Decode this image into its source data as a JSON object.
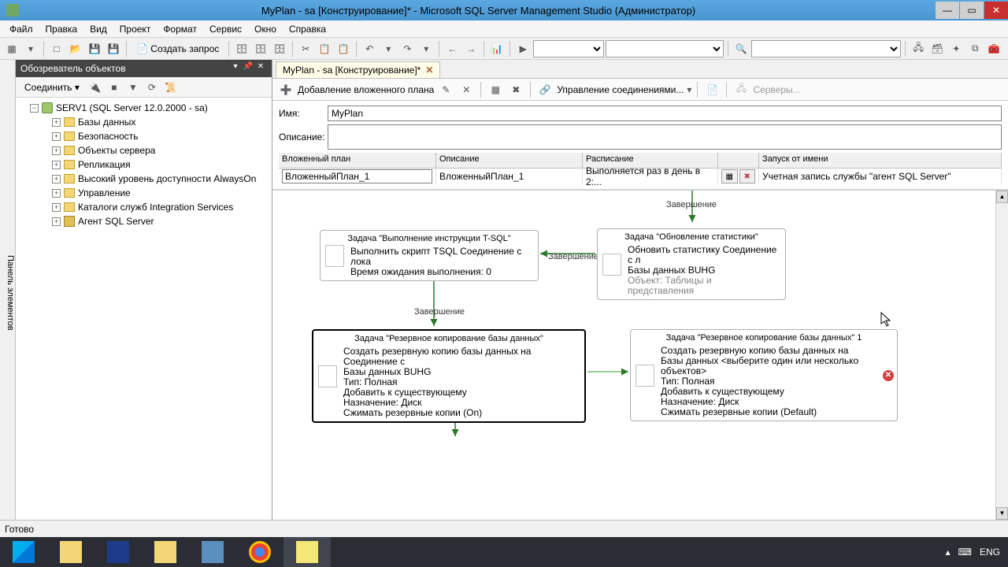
{
  "window": {
    "title": "MyPlan - sa [Конструирование]* - Microsoft SQL Server Management Studio (Администратор)"
  },
  "menu": {
    "file": "Файл",
    "edit": "Правка",
    "view": "Вид",
    "project": "Проект",
    "format": "Формат",
    "tools": "Сервис",
    "window": "Окно",
    "help": "Справка"
  },
  "toolbar": {
    "new_query": "Создать запрос"
  },
  "explorer": {
    "title": "Обозреватель объектов",
    "connect": "Соединить",
    "server": "SERV1 (SQL Server 12.0.2000 - sa)",
    "nodes": {
      "databases": "Базы данных",
      "security": "Безопасность",
      "server_objects": "Объекты сервера",
      "replication": "Репликация",
      "alwayson": "Высокий уровень доступности AlwaysOn",
      "management": "Управление",
      "integration": "Каталоги служб Integration Services",
      "agent": "Агент SQL Server"
    }
  },
  "side_panel": "Панель элементов",
  "tab": {
    "label": "MyPlan - sa [Конструирование]*"
  },
  "plan_toolbar": {
    "add_subplan": "Добавление вложенного плана",
    "connections": "Управление соединениями...",
    "servers": "Серверы..."
  },
  "form": {
    "name_label": "Имя:",
    "name_value": "MyPlan",
    "desc_label": "Описание:",
    "desc_value": ""
  },
  "grid": {
    "hdr": {
      "subplan": "Вложенный план",
      "description": "Описание",
      "schedule": "Расписание",
      "runas": "Запуск от имени"
    },
    "row": {
      "name": "ВложенныйПлан_1",
      "desc": "ВложенныйПлан_1",
      "schedule": "Выполняется раз в день в 2:...",
      "runas": "Учетная запись службы \"агент SQL Server\""
    }
  },
  "canvas": {
    "completion": "Завершение",
    "task_tsql": {
      "title": "Задача \"Выполнение инструкции T-SQL\"",
      "line1": "Выполнить скрипт TSQL Соединение с лока",
      "line2": "Время ожидания выполнения: 0"
    },
    "task_stats": {
      "title": "Задача \"Обновление статистики\"",
      "line1": "Обновить статистику Соединение с л",
      "line2": "Базы данных BUHG",
      "line3": "Объект: Таблицы и представления"
    },
    "task_backup": {
      "title": "Задача \"Резервное копирование базы данных\"",
      "line1": "Создать резервную копию базы данных на Соединение с",
      "line2": "Базы данных BUHG",
      "line3": "Тип: Полная",
      "line4": "Добавить к существующему",
      "line5": "Назначение: Диск",
      "line6": "Сжимать резервные копии (On)"
    },
    "task_backup1": {
      "title": "Задача \"Резервное копирование базы данных\" 1",
      "line1": "Создать резервную копию базы данных на",
      "line2": "Базы данных <выберите один или несколько объектов>",
      "line3": "Тип: Полная",
      "line4": "Добавить к существующему",
      "line5": "Назначение: Диск",
      "line6": "Сжимать резервные копии (Default)"
    }
  },
  "status": {
    "ready": "Готово"
  },
  "taskbar": {
    "lang": "ENG"
  }
}
